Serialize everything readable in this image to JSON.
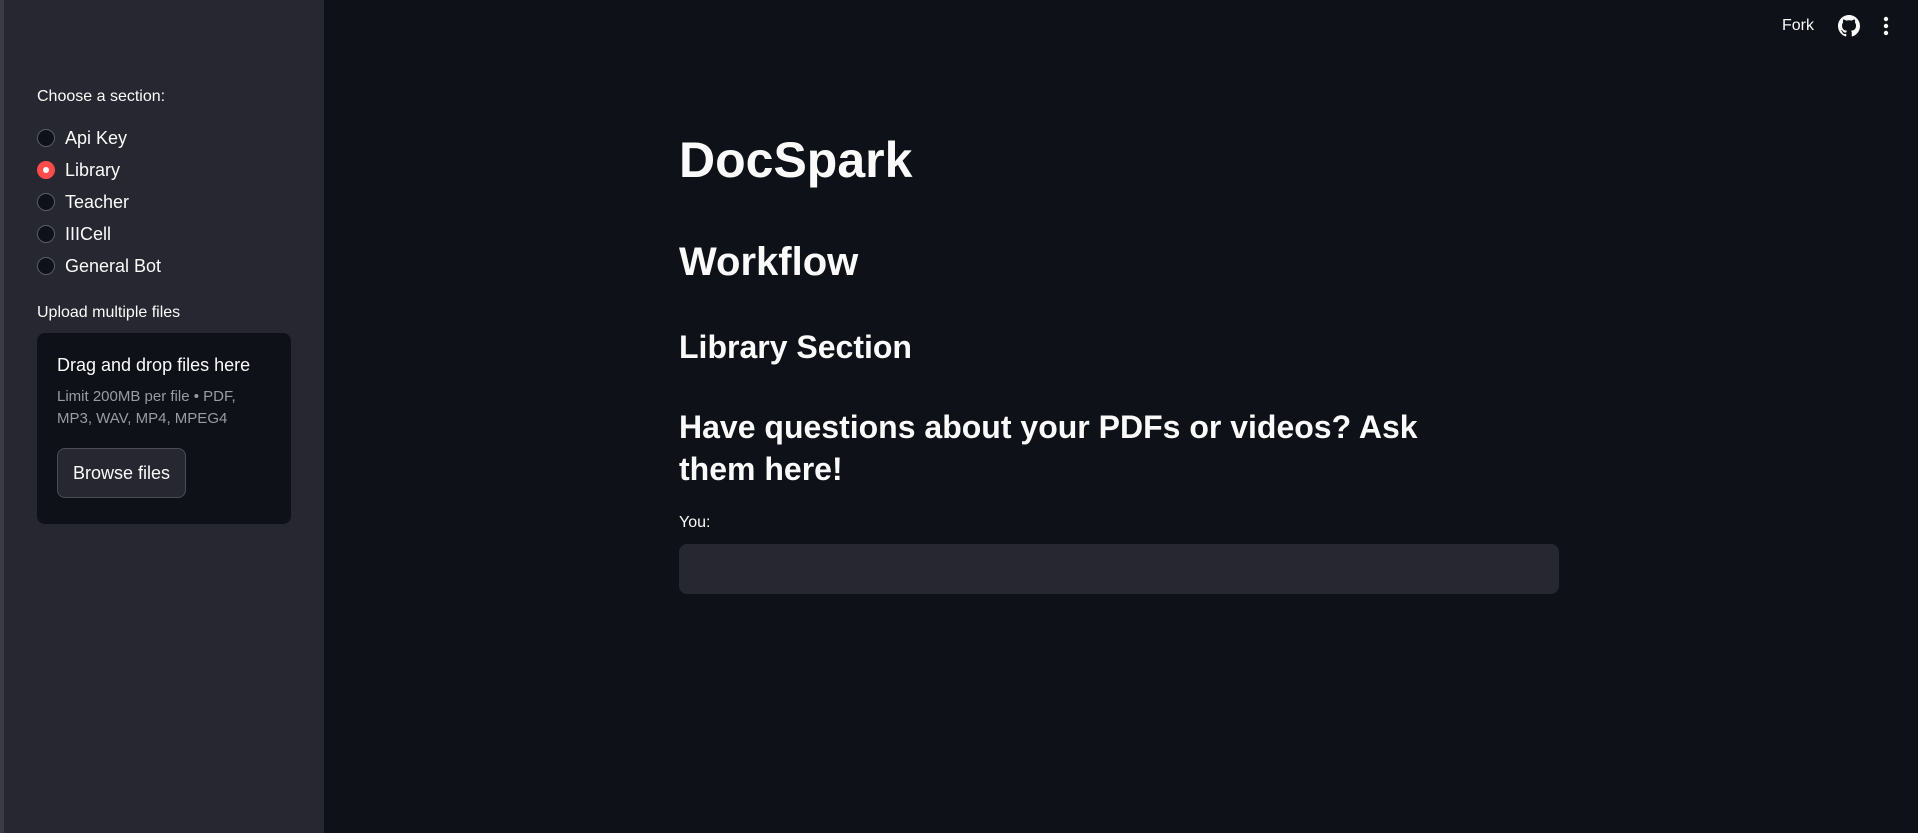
{
  "sidebar": {
    "section_label": "Choose a section:",
    "sections": [
      {
        "label": "Api Key",
        "selected": false
      },
      {
        "label": "Library",
        "selected": true
      },
      {
        "label": "Teacher",
        "selected": false
      },
      {
        "label": "IIICell",
        "selected": false
      },
      {
        "label": "General Bot",
        "selected": false
      }
    ],
    "upload_label": "Upload multiple files",
    "upload": {
      "title": "Drag and drop files here",
      "limit_line1": "Limit 200MB per file • PDF,",
      "limit_line2": "MP3, WAV, MP4, MPEG4",
      "browse_label": "Browse files"
    }
  },
  "topbar": {
    "fork_label": "Fork",
    "github_icon": "github-icon",
    "menu_icon": "more-vertical-icon"
  },
  "main": {
    "title": "DocSpark",
    "workflow_heading": "Workflow",
    "section_heading": "Library Section",
    "prompt_heading": "Have questions about your PDFs or videos? Ask them here!",
    "input_label": "You:",
    "input_value": ""
  },
  "colors": {
    "background": "#0e1117",
    "sidebar": "#262730",
    "accent": "#ff4b4b",
    "text": "#fafafa"
  }
}
